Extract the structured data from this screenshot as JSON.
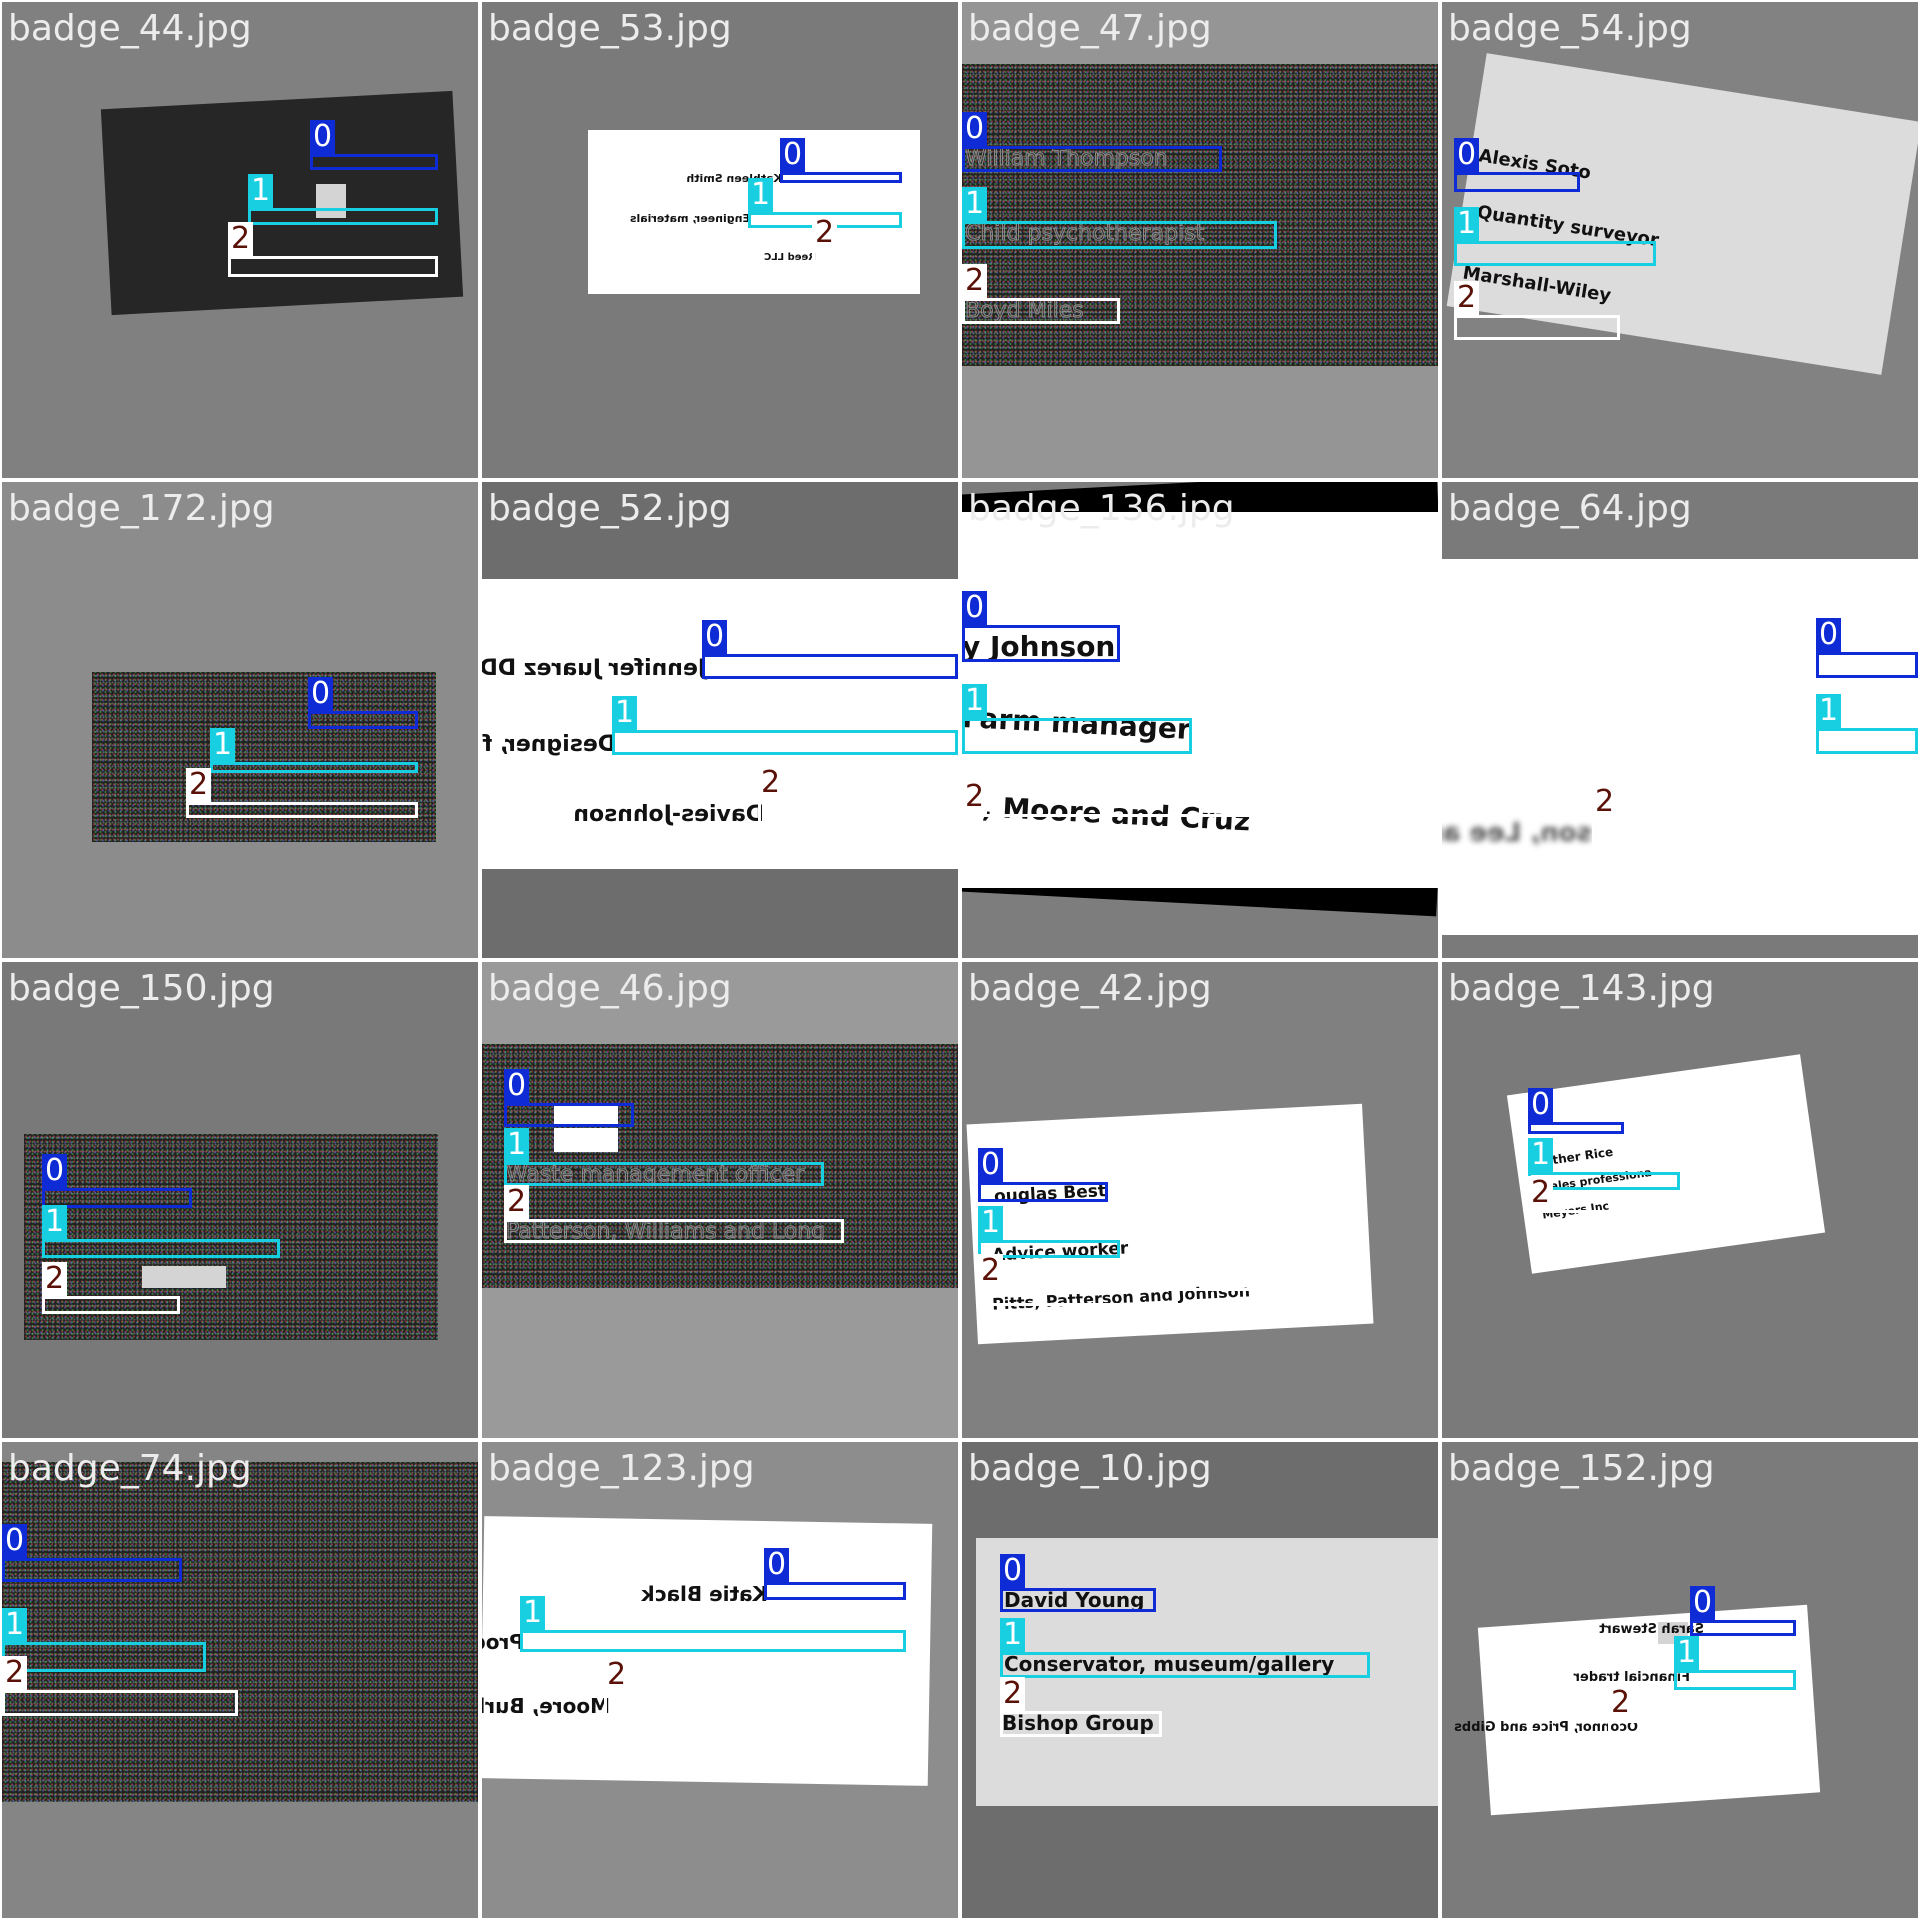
{
  "grid": {
    "tiles": [
      {
        "title": "badge_44.jpg",
        "bg": "#808080",
        "card_style": "dark",
        "texts": [
          "",
          "",
          ""
        ],
        "labels": [
          "0",
          "1",
          "2"
        ]
      },
      {
        "title": "badge_53.jpg",
        "bg": "#7a7a7a",
        "card_style": "white",
        "texts": [
          "Kathleen Smith",
          "Engineer, materials",
          "Reed LLC"
        ],
        "labels": [
          "0",
          "1",
          "2"
        ]
      },
      {
        "title": "badge_47.jpg",
        "bg": "#959595",
        "card_style": "noise",
        "texts": [
          "William Thompson",
          "Child psychotherapist",
          "Boyd Miles"
        ],
        "labels": [
          "0",
          "1",
          "2"
        ]
      },
      {
        "title": "badge_54.jpg",
        "bg": "#828282",
        "card_style": "light",
        "texts": [
          "Alexis Soto",
          "Quantity surveyor",
          "Marshall-Wiley"
        ],
        "labels": [
          "0",
          "1",
          "2"
        ]
      },
      {
        "title": "badge_172.jpg",
        "bg": "#8c8c8c",
        "card_style": "noise",
        "texts": [
          "",
          "",
          ""
        ],
        "labels": [
          "0",
          "1",
          "2"
        ]
      },
      {
        "title": "badge_52.jpg",
        "bg": "#6d6d6d",
        "card_style": "white",
        "texts": [
          "Jennifer Juarez DDS",
          "Designer, fashion/clothing",
          "Davies-Johnson"
        ],
        "labels": [
          "0",
          "1",
          "2"
        ]
      },
      {
        "title": "badge_136.jpg",
        "bg": "#7d7d7d",
        "card_style": "white",
        "texts": [
          "y Johnson",
          "Farm manager",
          "h, Moore and Cruz"
        ],
        "labels": [
          "0",
          "1",
          "2"
        ]
      },
      {
        "title": "badge_64.jpg",
        "bg": "#7a7a7a",
        "card_style": "white",
        "texts": [
          "",
          "",
          "son, Lee and Lawson"
        ],
        "labels": [
          "0",
          "1",
          "2"
        ]
      },
      {
        "title": "badge_150.jpg",
        "bg": "#797979",
        "card_style": "noise",
        "texts": [
          "",
          "",
          ""
        ],
        "labels": [
          "0",
          "1",
          "2"
        ]
      },
      {
        "title": "badge_46.jpg",
        "bg": "#9a9a9a",
        "card_style": "noise",
        "texts": [
          "",
          "Waste management officer",
          "Patterson, Williams and Long"
        ],
        "labels": [
          "0",
          "1",
          "2"
        ]
      },
      {
        "title": "badge_42.jpg",
        "bg": "#808080",
        "card_style": "white",
        "texts": [
          "ouglas Best",
          "Advice worker",
          "Pitts, Patterson and Johnson"
        ],
        "labels": [
          "0",
          "1",
          "2"
        ]
      },
      {
        "title": "badge_143.jpg",
        "bg": "#7a7a7a",
        "card_style": "white",
        "texts": [
          "eather Rice",
          "/ sales professiona",
          "Meyers Inc"
        ],
        "labels": [
          "0",
          "1",
          "2"
        ]
      },
      {
        "title": "badge_74.jpg",
        "bg": "#858585",
        "card_style": "noise",
        "texts": [
          "",
          "",
          ""
        ],
        "labels": [
          "0",
          "1",
          "2"
        ]
      },
      {
        "title": "badge_123.jpg",
        "bg": "#8d8d8d",
        "card_style": "white",
        "texts": [
          "Katie Black",
          "Production assistant, television",
          "Moore, Burke and Knight"
        ],
        "labels": [
          "0",
          "1",
          "2"
        ]
      },
      {
        "title": "badge_10.jpg",
        "bg": "#6d6d6d",
        "card_style": "light",
        "texts": [
          "David Young",
          "Conservator, museum/gallery",
          "Bishop Group"
        ],
        "labels": [
          "0",
          "1",
          "2"
        ]
      },
      {
        "title": "badge_152.jpg",
        "bg": "#7b7b7b",
        "card_style": "white",
        "texts": [
          "Sarah Stewart",
          "Financial trader",
          "Oconnor, Price and Gibbs"
        ],
        "labels": [
          "0",
          "1",
          "2"
        ]
      }
    ]
  },
  "colors": {
    "class_0": "#0e2bd6",
    "class_1": "#18cfe2",
    "class_2": "#ffffff",
    "label_2_text": "#5a1208"
  }
}
